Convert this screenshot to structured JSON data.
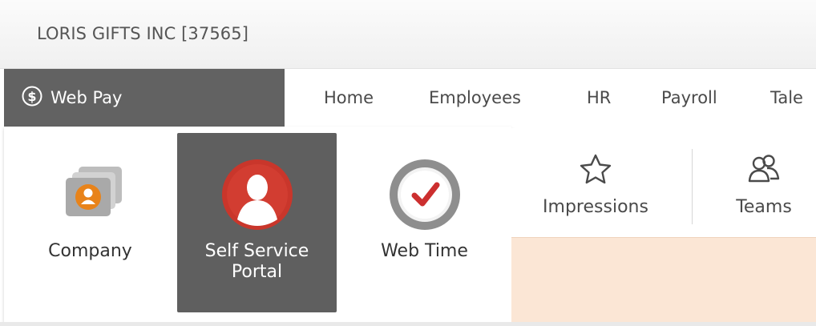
{
  "header": {
    "company_name": "LORIS GIFTS INC [37565]"
  },
  "product_tab": {
    "label": "Web Pay",
    "icon": "dollar-circle-icon"
  },
  "topnav": {
    "items": [
      {
        "label": "Home"
      },
      {
        "label": "Employees"
      },
      {
        "label": "HR"
      },
      {
        "label": "Payroll"
      },
      {
        "label": "Tale"
      }
    ]
  },
  "app_switcher": {
    "tiles": [
      {
        "label": "Company",
        "icon": "company-cards-icon",
        "active": false
      },
      {
        "label": "Self Service\nPortal",
        "icon": "person-circle-icon",
        "active": true
      },
      {
        "label": "Web Time",
        "icon": "clock-check-icon",
        "active": false
      }
    ]
  },
  "toolbar": {
    "items": [
      {
        "label": "Impressions",
        "icon": "star-outline-icon"
      },
      {
        "label": "Teams",
        "icon": "people-outline-icon"
      }
    ]
  },
  "colors": {
    "product_tab_bg": "#626262",
    "active_tile_bg": "#5f5f5f",
    "self_service_red": "#c9362b",
    "company_orange": "#e8831a",
    "webtime_red": "#cc2f2f",
    "peach_strip": "#fbe6d5"
  }
}
